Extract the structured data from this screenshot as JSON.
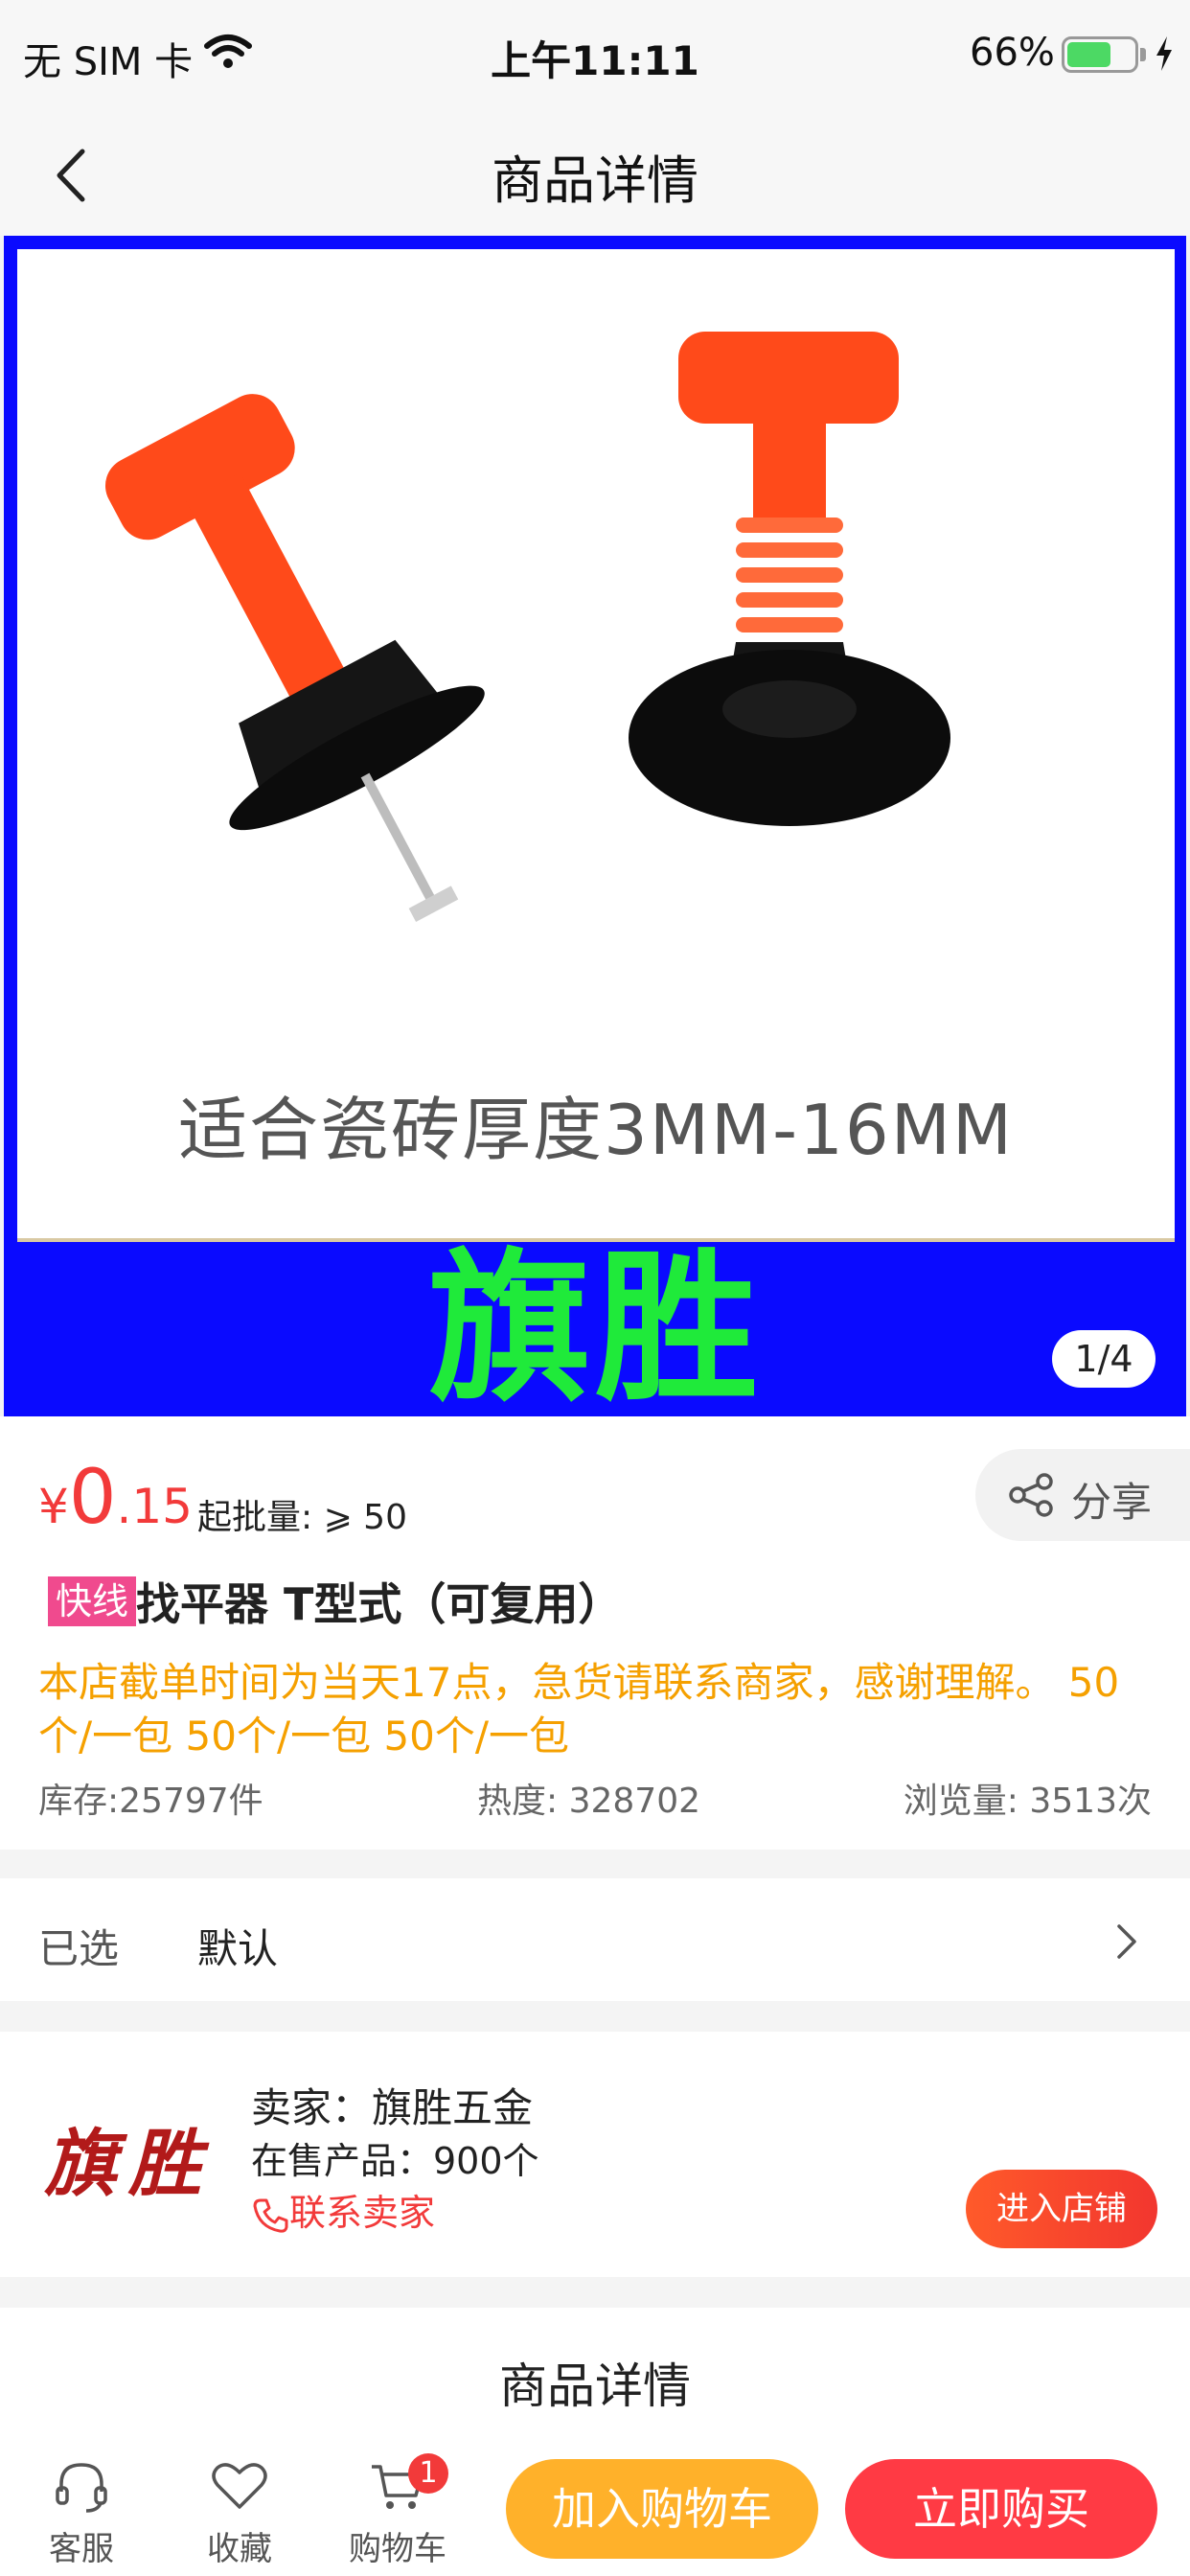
{
  "status_bar": {
    "carrier": "无 SIM 卡",
    "time": "上午11:11",
    "battery_percent": "66%",
    "battery_level": 0.66,
    "icons": [
      "wifi-icon",
      "battery-icon",
      "charging-bolt-icon"
    ]
  },
  "nav": {
    "title": "商品详情",
    "back_icon": "chevron-left-icon"
  },
  "hero": {
    "caption": "适合瓷砖厚度3MM-16MM",
    "brand_banner": "旗胜",
    "pager": "1/4",
    "colors": {
      "frame": "#0a0aff",
      "brand_text": "#1fea3a",
      "product_orange": "#ff4a1a"
    }
  },
  "product": {
    "price_currency": "¥",
    "price_integer": "0",
    "price_decimal": ".15",
    "moq_label": "起批量: ⩾ 50",
    "share_label": "分享",
    "tag": "快线",
    "title": "找平器 T型式（可复用）",
    "notice": "本店截单时间为当天17点，急货请联系商家，感谢理解。 50个/一包 50个/一包 50个/一包",
    "stock": "库存:25797件",
    "heat": "热度: 328702",
    "views": "浏览量: 3513次",
    "colors": {
      "price": "#f23a3a",
      "notice": "#f5a000",
      "tag": "#f04a8e"
    }
  },
  "selection": {
    "label": "已选",
    "value": "默认"
  },
  "seller": {
    "logo_text": "旗胜",
    "name": "卖家：旗胜五金",
    "products": "在售产品：900个",
    "contact": "联系卖家",
    "enter_shop": "进入店铺"
  },
  "details": {
    "header": "商品详情"
  },
  "bottom_bar": {
    "customer_service": "客服",
    "favorite": "收藏",
    "cart": "购物车",
    "cart_badge": "1",
    "add_to_cart": "加入购物车",
    "buy_now": "立即购买"
  }
}
